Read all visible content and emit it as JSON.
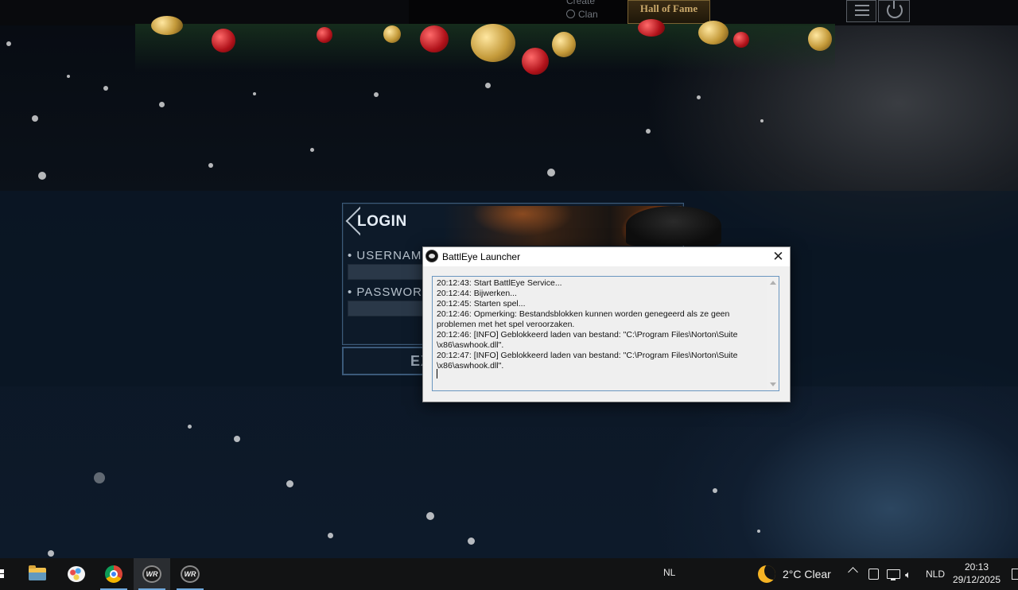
{
  "game": {
    "top_menu": {
      "create_label": "Create",
      "clan_label": "Clan",
      "hall_of_fame_label": "Hall of Fame"
    },
    "login": {
      "title": "LOGIN",
      "username_label": "USERNAME",
      "password_label": "PASSWORD",
      "exit_label": "EX"
    }
  },
  "dialog": {
    "title": "BattlEye Launcher",
    "close_glyph": "✕",
    "log_lines": [
      "20:12:43: Start BattlEye Service...",
      "20:12:44: Bijwerken...",
      "20:12:45: Starten spel...",
      "20:12:46: Opmerking: Bestandsblokken kunnen worden genegeerd als ze geen\nproblemen met het spel veroorzaken.",
      "20:12:46: [INFO] Geblokkeerd laden van bestand: \"C:\\Program Files\\Norton\\Suite\n\\x86\\aswhook.dll\".",
      "20:12:47: [INFO] Geblokkeerd laden van bestand: \"C:\\Program Files\\Norton\\Suite\n\\x86\\aswhook.dll\"."
    ]
  },
  "taskbar": {
    "apps": [
      {
        "name": "file-explorer",
        "icon": "folder-icon"
      },
      {
        "name": "paint",
        "icon": "paint-icon"
      },
      {
        "name": "chrome",
        "icon": "chrome-icon"
      },
      {
        "name": "warrock",
        "icon": "wr-icon",
        "label": "WR",
        "active": true
      },
      {
        "name": "warrock-2",
        "icon": "wr-icon",
        "label": "WR"
      }
    ],
    "input_indicator": "NL",
    "weather": "2°C  Clear",
    "language": "NLD",
    "time": "20:13",
    "date": "29/12/2025"
  },
  "colors": {
    "accent": "#6fa8dc",
    "dialog_border": "#6a96c0",
    "login_border": "#3b5a7a"
  }
}
